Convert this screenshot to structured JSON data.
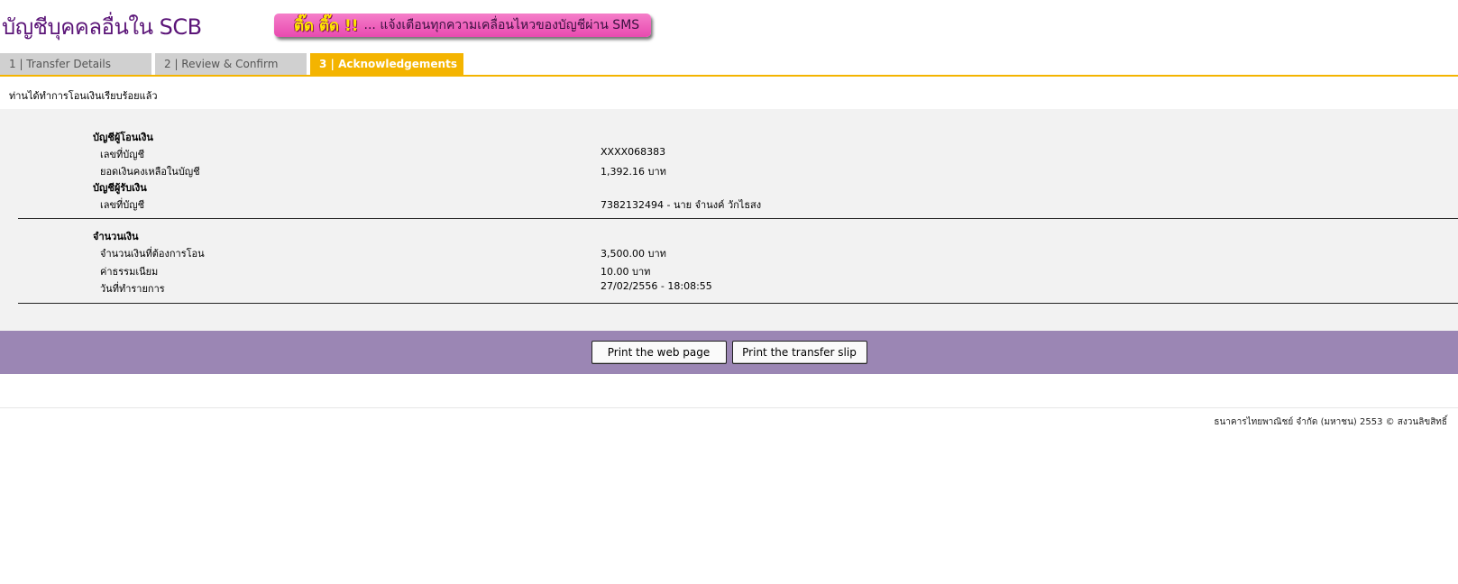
{
  "header": {
    "title": "บัญชีบุคคลอื่นใน SCB",
    "sms_banner": {
      "highlight": "ติ๊ด ติ๊ด !!",
      "text": "... แจ้งเตือนทุกความเคลื่อนไหวของบัญชีผ่าน SMS"
    }
  },
  "tabs": [
    {
      "label": "1 | Transfer Details",
      "active": false
    },
    {
      "label": "2 | Review & Confirm",
      "active": false
    },
    {
      "label": "3 | Acknowledgements",
      "active": true
    }
  ],
  "success_message": "ท่านได้ทำการโอนเงินเรียบร้อยแล้ว",
  "from_account": {
    "title": "บัญชีผู้โอนเงิน",
    "account_label": "เลขที่บัญชี",
    "account_value": "XXXX068383",
    "balance_label": "ยอดเงินคงเหลือในบัญชี",
    "balance_value": "1,392.16 บาท"
  },
  "to_account": {
    "title": "บัญชีผู้รับเงิน",
    "account_label": "เลขที่บัญชี",
    "account_value": "7382132494 - นาย จำนงค์ วักไธสง"
  },
  "amount": {
    "title": "จำนวนเงิน",
    "amount_label": "จำนวนเงินที่ต้องการโอน",
    "amount_value": "3,500.00 บาท",
    "fee_label": "ค่าธรรมเนียม",
    "fee_value": "10.00  บาท",
    "date_label": "วันที่ทำรายการ",
    "date_value": "27/02/2556 - 18:08:55"
  },
  "actions": {
    "print_page": "Print the web page",
    "print_slip": "Print the transfer slip"
  },
  "footer": {
    "copyright": "ธนาคารไทยพาณิชย์ จำกัด (มหาชน) 2553 © สงวนลิขสิทธิ์"
  },
  "colors": {
    "title_purple": "#5b1578",
    "active_tab": "#f4b400",
    "inactive_tab": "#d0d0d0",
    "panel_bg": "#f2f2f2",
    "action_bar": "#9b86b4",
    "banner_pink": "#f57ec9"
  }
}
